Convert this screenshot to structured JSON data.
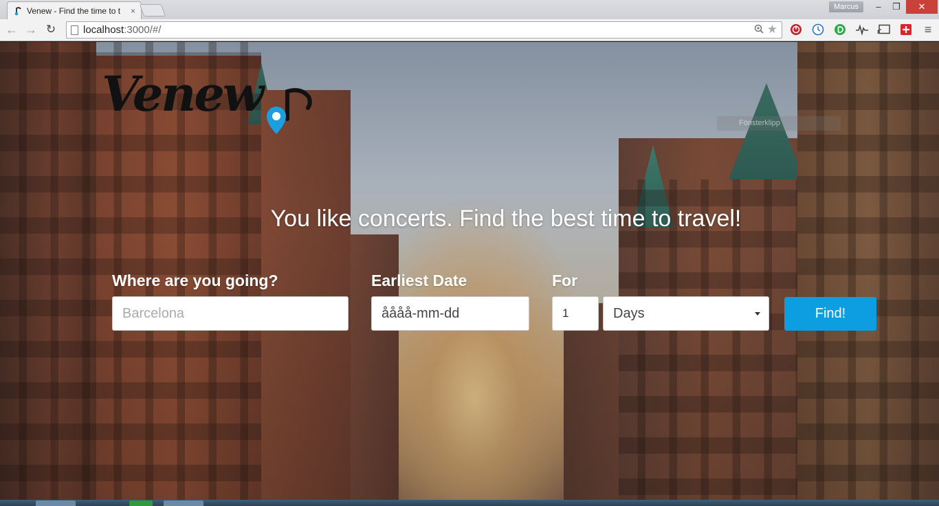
{
  "browser": {
    "tab_title": "Venew - Find the time to t",
    "tab_close": "×",
    "profile_name": "Marcus",
    "url_host": "localhost",
    "url_path": ":3000/#/",
    "window_controls": {
      "minimize": "–",
      "maximize": "❐",
      "close": "✕"
    },
    "nav": {
      "back": "←",
      "forward": "→",
      "reload": "↻"
    },
    "extensions": [
      "stop-icon",
      "clock-icon",
      "green-d-icon",
      "pulse-icon",
      "cast-icon",
      "red-plus-icon"
    ],
    "menu": "≡"
  },
  "page": {
    "overlay_text": "Fönsterklipp",
    "logo_text": "Venew",
    "tagline": "You like concerts. Find the best time to travel!",
    "form": {
      "destination_label": "Where are you going?",
      "destination_placeholder": "Barcelona",
      "date_label": "Earliest Date",
      "date_value": "åååå-mm-dd",
      "for_label": "For",
      "duration_value": "1",
      "duration_unit": "Days",
      "submit_label": "Find!"
    }
  },
  "colors": {
    "accent": "#0c9ee0",
    "pin_blue": "#1b9fe0",
    "close_red": "#c9423a"
  }
}
